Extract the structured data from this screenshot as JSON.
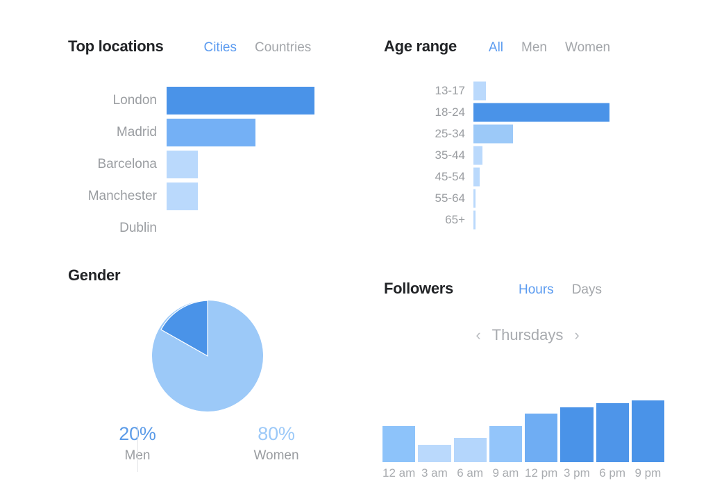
{
  "panels": {
    "locations": {
      "title": "Top locations",
      "tabs": [
        {
          "label": "Cities",
          "active": true
        },
        {
          "label": "Countries",
          "active": false
        }
      ]
    },
    "age": {
      "title": "Age range",
      "tabs": [
        {
          "label": "All",
          "active": true
        },
        {
          "label": "Men",
          "active": false
        },
        {
          "label": "Women",
          "active": false
        }
      ]
    },
    "gender": {
      "title": "Gender",
      "stats": [
        {
          "percent": "20%",
          "name": "Men",
          "color": "#5b9be8"
        },
        {
          "percent": "80%",
          "name": "Women",
          "color": "#9cc9f8"
        }
      ]
    },
    "followers": {
      "title": "Followers",
      "tabs": [
        {
          "label": "Hours",
          "active": true
        },
        {
          "label": "Days",
          "active": false
        }
      ],
      "day_nav": {
        "prev_icon": "chevron-left-icon",
        "prev_glyph": "‹",
        "label": "Thursdays",
        "next_icon": "chevron-right-icon",
        "next_glyph": "›"
      }
    }
  },
  "colors": {
    "accent": "#5b9bf0",
    "bar_dark": "#4a93e8",
    "bar_mid": "#74b0f5",
    "bar_light": "#bad9fc",
    "bar_lighter": "#cde3fd",
    "label_grey": "#9a9da1",
    "title_dark": "#222427"
  },
  "chart_data": [
    {
      "type": "bar",
      "orientation": "horizontal",
      "title": "Top locations",
      "categories": [
        "London",
        "Madrid",
        "Barcelona",
        "Manchester",
        "Dublin"
      ],
      "values": [
        100,
        60,
        21,
        21,
        0
      ],
      "colors": [
        "#4a93e8",
        "#74b0f5",
        "#bad9fc",
        "#bad9fc",
        "#bad9fc"
      ],
      "xlabel": "",
      "ylabel": "",
      "xlim": [
        0,
        100
      ],
      "grid": false,
      "legend": "none"
    },
    {
      "type": "bar",
      "orientation": "horizontal",
      "title": "Age range",
      "categories": [
        "13-17",
        "18-24",
        "25-34",
        "35-44",
        "45-54",
        "55-64",
        "65+"
      ],
      "values": [
        9,
        100,
        29,
        6.5,
        4.5,
        1.5,
        1.5
      ],
      "colors": [
        "#bad9fc",
        "#4a93e8",
        "#9cc9f8",
        "#bad9fc",
        "#bad9fc",
        "#bad9fc",
        "#bad9fc"
      ],
      "xlabel": "",
      "ylabel": "",
      "xlim": [
        0,
        100
      ],
      "grid": false,
      "legend": "none"
    },
    {
      "type": "pie",
      "title": "Gender",
      "labels": [
        "Men",
        "Women"
      ],
      "values": [
        20,
        80
      ],
      "colors": [
        "#4a93e8",
        "#9cc9f8"
      ],
      "start_angle_deg": 0,
      "direction": "counterclockwise",
      "legend": "below"
    },
    {
      "type": "bar",
      "orientation": "vertical",
      "title": "Followers",
      "subtitle": "Thursdays",
      "categories": [
        "12 am",
        "3 am",
        "6 am",
        "9 am",
        "12 pm",
        "3 pm",
        "6 pm",
        "9 pm"
      ],
      "values": [
        52,
        25,
        35,
        52,
        70,
        79,
        85,
        89
      ],
      "colors": [
        "#8dc3fa",
        "#bad9fc",
        "#b4d6fc",
        "#93c5fa",
        "#6fadf3",
        "#4a93e8",
        "#4e95e9",
        "#4a93e8"
      ],
      "xlabel": "",
      "ylabel": "",
      "ylim": [
        0,
        100
      ],
      "grid": false,
      "legend": "none"
    }
  ]
}
